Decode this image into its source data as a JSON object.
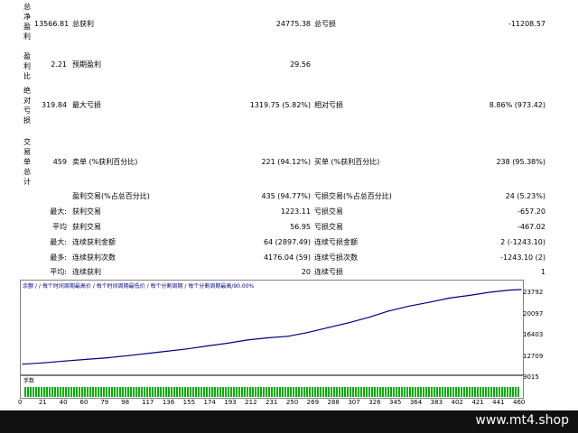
{
  "rows": {
    "net_profit_label": "总净盈利",
    "net_profit_value": "13566.81",
    "gross_profit_label": "总获利",
    "gross_profit_value": "24775.38",
    "gross_loss_label": "总亏损",
    "gross_loss_value": "-11208.57",
    "profit_factor_label": "盈利比",
    "profit_factor_value": "2.21",
    "expected_payoff_label": "预期盈利",
    "expected_payoff_value": "29.56",
    "abs_dd_label": "绝对亏损",
    "abs_dd_value": "319.84",
    "max_dd_label": "最大亏损",
    "max_dd_value": "1319.75 (5.82%)",
    "rel_dd_label": "相对亏损",
    "rel_dd_value": "8.86% (973.42)",
    "total_trades_label": "交易单总计",
    "total_trades_value": "459",
    "short_label": "卖单 (%获利百分比)",
    "short_value": "221 (94.12%)",
    "long_label": "买单 (%获利百分比)",
    "long_value": "238 (95.38%)",
    "profit_trades_label": "盈利交易(%占总百分比)",
    "profit_trades_value": "435 (94.77%)",
    "loss_trades_label": "亏损交易(%占总百分比)",
    "loss_trades_value": "24 (5.23%)",
    "largest_prefix": "最大:",
    "largest_profit_label": "获利交易",
    "largest_profit_value": "1223.11",
    "largest_loss_label": "亏损交易",
    "largest_loss_value": "-657.20",
    "average_prefix": "平均",
    "avg_profit_label": "获利交易",
    "avg_profit_value": "56.95",
    "avg_loss_label": "亏损交易",
    "avg_loss_value": "-467.02",
    "max_prefix": "最大:",
    "max_cons_wins_label": "连续获利金额",
    "max_cons_wins_value": "64 (2897.49)",
    "max_cons_losses_label": "连续亏损金额",
    "max_cons_losses_value": "2 (-1243.10)",
    "maximal_prefix": "最多:",
    "maximal_cons_profit_label": "连续获利次数",
    "maximal_cons_profit_value": "4176.04 (59)",
    "maximal_cons_loss_label": "连续亏损次数",
    "maximal_cons_loss_value": "-1243.10 (2)",
    "avg_cons_prefix": "平均:",
    "avg_cons_wins_label": "连续获利",
    "avg_cons_wins_value": "20",
    "avg_cons_losses_label": "连续亏损",
    "avg_cons_losses_value": "1"
  },
  "chart": {
    "legend_balance": "余额",
    "legend_bar": "/",
    "legend_text": "/ 每个时间周期最高价 / 每个时间周期最低价 / 每个分割周期 / 每个分割周期最高/90.00%",
    "volume_label": "手数",
    "line_color": "#000080",
    "bar_color": "#00b000",
    "y_ticks": [
      "23792",
      "20097",
      "16403",
      "12709",
      "9015"
    ],
    "x_ticks": [
      "0",
      "21",
      "40",
      "60",
      "79",
      "98",
      "117",
      "136",
      "155",
      "174",
      "193",
      "212",
      "231",
      "250",
      "269",
      "288",
      "307",
      "326",
      "345",
      "364",
      "383",
      "402",
      "421",
      "441",
      "460"
    ]
  },
  "chart_data": {
    "type": "line",
    "title": "",
    "xlabel": "",
    "ylabel": "",
    "xlim": [
      0,
      470
    ],
    "ylim": [
      9015,
      23792
    ],
    "series": [
      {
        "values": [
          [
            0,
            9900
          ],
          [
            20,
            10150
          ],
          [
            40,
            10500
          ],
          [
            60,
            10800
          ],
          [
            80,
            11100
          ],
          [
            100,
            11500
          ],
          [
            120,
            11950
          ],
          [
            136,
            12300
          ],
          [
            155,
            12750
          ],
          [
            174,
            13300
          ],
          [
            193,
            13800
          ],
          [
            212,
            14400
          ],
          [
            231,
            14800
          ],
          [
            250,
            15100
          ],
          [
            269,
            15800
          ],
          [
            288,
            16700
          ],
          [
            307,
            17600
          ],
          [
            326,
            18600
          ],
          [
            345,
            19800
          ],
          [
            364,
            20700
          ],
          [
            383,
            21400
          ],
          [
            402,
            22200
          ],
          [
            421,
            22700
          ],
          [
            441,
            23300
          ],
          [
            460,
            23700
          ],
          [
            470,
            23792
          ]
        ]
      }
    ]
  },
  "footer": {
    "site": "www.mt4.shop"
  }
}
